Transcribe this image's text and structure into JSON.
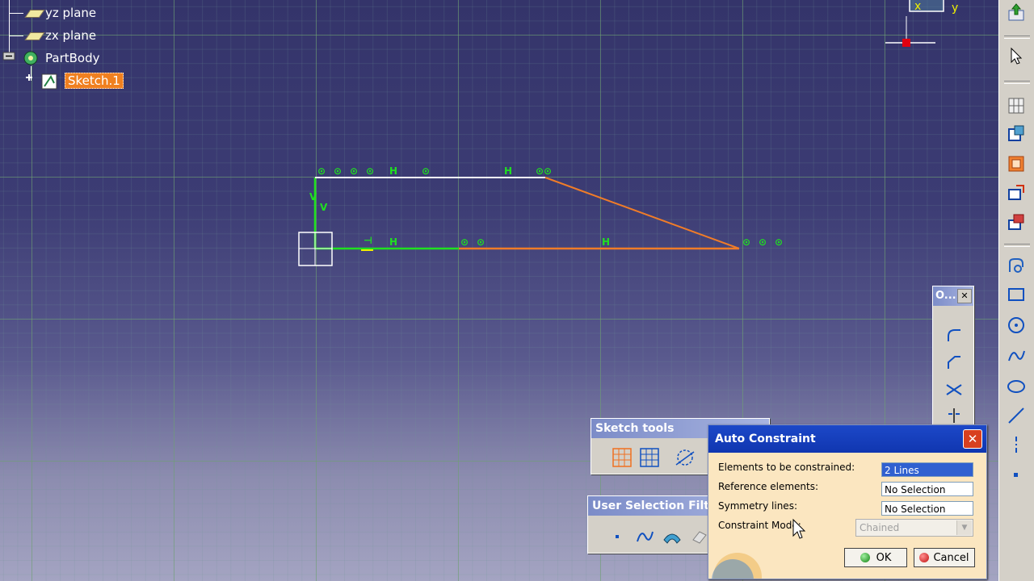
{
  "tree": {
    "items": [
      {
        "label": "yz plane"
      },
      {
        "label": "zx plane"
      },
      {
        "label": "PartBody"
      },
      {
        "label": "Sketch.1"
      }
    ]
  },
  "compass": {
    "x_label": "x",
    "y_label": "y"
  },
  "sketch": {
    "constraint_symbols": {
      "top": [
        "⊙",
        "⊙",
        "⊙",
        "⊙",
        "H",
        "⊙",
        "H",
        "⊙⊙"
      ],
      "vertical": [
        "V",
        "V"
      ],
      "bottom": [
        "⊣",
        "H",
        "⊙",
        "⊙",
        "H"
      ],
      "end": [
        "⊙",
        "⊙",
        "⊙"
      ]
    }
  },
  "operation_toolbar": {
    "title": "O..."
  },
  "sketch_tools": {
    "title": "Sketch tools"
  },
  "selection_filter": {
    "title": "User Selection Filter"
  },
  "dialog": {
    "title": "Auto Constraint",
    "close_glyph": "✕",
    "fields": [
      {
        "label": "Elements to be constrained:",
        "value": "2 Lines"
      },
      {
        "label": "Reference elements:",
        "value": "No Selection"
      },
      {
        "label": "Symmetry lines:",
        "value": "No Selection"
      }
    ],
    "mode_label": "Constraint Mode:",
    "mode_value": "Chained",
    "ok_label": "OK",
    "cancel_label": "Cancel"
  },
  "colors": {
    "background": "#3c3c74",
    "grid": "#6ea06e",
    "sketch_green": "#20e020",
    "sketch_orange": "#f07c28",
    "selection_white": "#ffffff",
    "dialog_bg": "#fbe6c0",
    "title_blue": "#1c48c8"
  }
}
